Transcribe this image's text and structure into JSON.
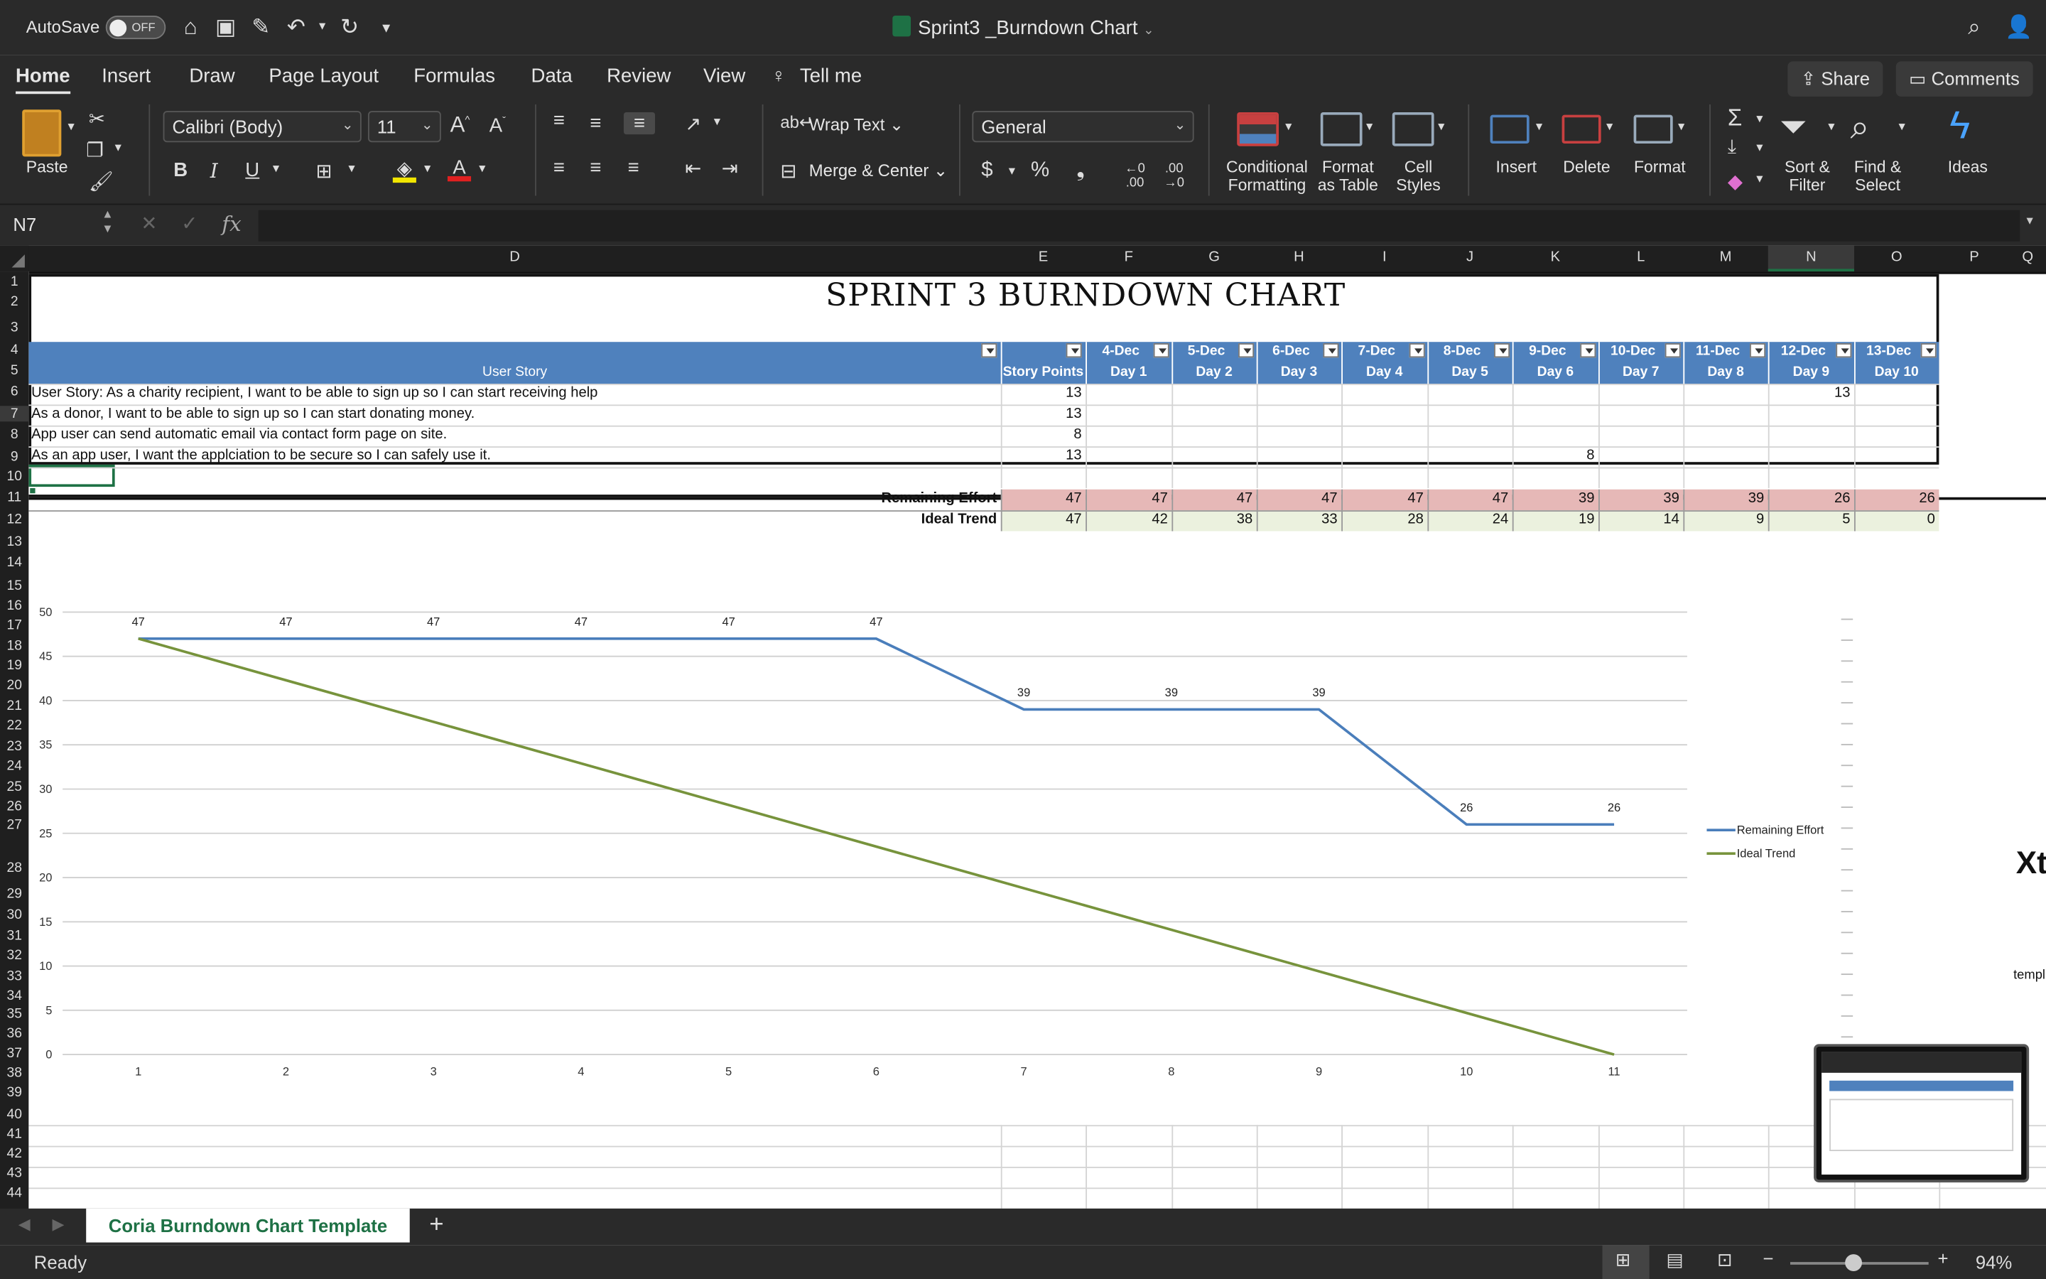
{
  "titlebar": {
    "autosave_label": "AutoSave",
    "autosave_state": "OFF",
    "doc_title": "Sprint3 _Burndown Chart"
  },
  "ribbon": {
    "tabs": [
      "Home",
      "Insert",
      "Draw",
      "Page Layout",
      "Formulas",
      "Data",
      "Review",
      "View"
    ],
    "tell_me": "Tell me",
    "share": "Share",
    "comments": "Comments",
    "paste": "Paste",
    "font_name": "Calibri (Body)",
    "font_size": "11",
    "wrap_text": "Wrap Text",
    "merge_center": "Merge & Center",
    "number_format": "General",
    "conditional_formatting": "Conditional\nFormatting",
    "format_as_table": "Format\nas Table",
    "cell_styles": "Cell\nStyles",
    "insert": "Insert",
    "delete": "Delete",
    "format": "Format",
    "sort_filter": "Sort &\nFilter",
    "find_select": "Find &\nSelect",
    "ideas": "Ideas"
  },
  "formula_bar": {
    "name_box": "N7",
    "fx": "fx",
    "content": ""
  },
  "columns": [
    "D",
    "E",
    "F",
    "G",
    "H",
    "I",
    "J",
    "K",
    "L",
    "M",
    "N",
    "O",
    "P",
    "Q"
  ],
  "rows": [
    "1",
    "2",
    "3",
    "4",
    "5",
    "6",
    "7",
    "8",
    "9",
    "10",
    "11",
    "12",
    "13",
    "14",
    "15",
    "16",
    "17",
    "18",
    "19",
    "20",
    "21",
    "22",
    "23",
    "24",
    "25",
    "26",
    "27",
    "28",
    "29",
    "30",
    "31",
    "32",
    "33",
    "34",
    "35",
    "36",
    "37",
    "38",
    "39",
    "40",
    "41",
    "42",
    "43",
    "44"
  ],
  "sheet": {
    "title": "SPRINT 3 BURNDOWN CHART",
    "header_user_story": "User Story",
    "header_story_points": "Story Points",
    "dates": [
      "4-Dec",
      "5-Dec",
      "6-Dec",
      "7-Dec",
      "8-Dec",
      "9-Dec",
      "10-Dec",
      "11-Dec",
      "12-Dec",
      "13-Dec"
    ],
    "days": [
      "Day 1",
      "Day 2",
      "Day 3",
      "Day 4",
      "Day 5",
      "Day 6",
      "Day 7",
      "Day 8",
      "Day 9",
      "Day 10"
    ],
    "stories": [
      {
        "text": "User Story: As a charity recipient, I want to be able to sign up so I can start receiving help",
        "points": "13"
      },
      {
        "text": "As a donor, I want to be able to sign up so I can start donating money.",
        "points": "13"
      },
      {
        "text": "App user can send automatic email via contact form page on site.",
        "points": "8"
      },
      {
        "text": "As an app user, I want the applciation to be secure so I can safely use it.",
        "points": "13"
      }
    ],
    "extra_values": [
      {
        "row": 0,
        "day": 8,
        "value": "13"
      },
      {
        "row": 3,
        "day": 5,
        "value": "8"
      }
    ],
    "remaining_label": "Remaining Effort",
    "remaining": [
      "47",
      "47",
      "47",
      "47",
      "47",
      "47",
      "39",
      "39",
      "39",
      "26",
      "26"
    ],
    "ideal_label": "Ideal Trend",
    "ideal": [
      "47",
      "42",
      "38",
      "33",
      "28",
      "24",
      "19",
      "14",
      "9",
      "5",
      "0"
    ],
    "side_text_big": "Xt",
    "side_text_small": "templ"
  },
  "chart_data": {
    "type": "line",
    "x": [
      1,
      2,
      3,
      4,
      5,
      6,
      7,
      8,
      9,
      10,
      11
    ],
    "series": [
      {
        "name": "Remaining Effort",
        "color": "#4a7ebb",
        "values": [
          47,
          47,
          47,
          47,
          47,
          47,
          39,
          39,
          39,
          26,
          26
        ]
      },
      {
        "name": "Ideal Trend",
        "color": "#77933c",
        "values": [
          47,
          42.3,
          37.6,
          32.9,
          28.2,
          23.5,
          18.8,
          14.1,
          9.4,
          4.7,
          0
        ]
      }
    ],
    "data_labels": {
      "series": "Remaining Effort",
      "points": [
        1,
        2,
        3,
        4,
        5,
        6,
        7,
        8,
        9,
        10,
        11
      ],
      "labels": [
        "47",
        "47",
        "47",
        "47",
        "47",
        "47",
        "39",
        "39",
        "39",
        "26",
        "26"
      ]
    },
    "ylim": [
      0,
      50
    ],
    "yticks": [
      "0",
      "5",
      "10",
      "15",
      "20",
      "25",
      "30",
      "35",
      "40",
      "45",
      "50"
    ],
    "xticks": [
      "1",
      "2",
      "3",
      "4",
      "5",
      "6",
      "7",
      "8",
      "9",
      "10",
      "11"
    ],
    "grid": true,
    "legend": "right"
  },
  "sheet_tab": "Coria Burndown Chart Template",
  "status": {
    "ready": "Ready",
    "zoom": "94%"
  }
}
